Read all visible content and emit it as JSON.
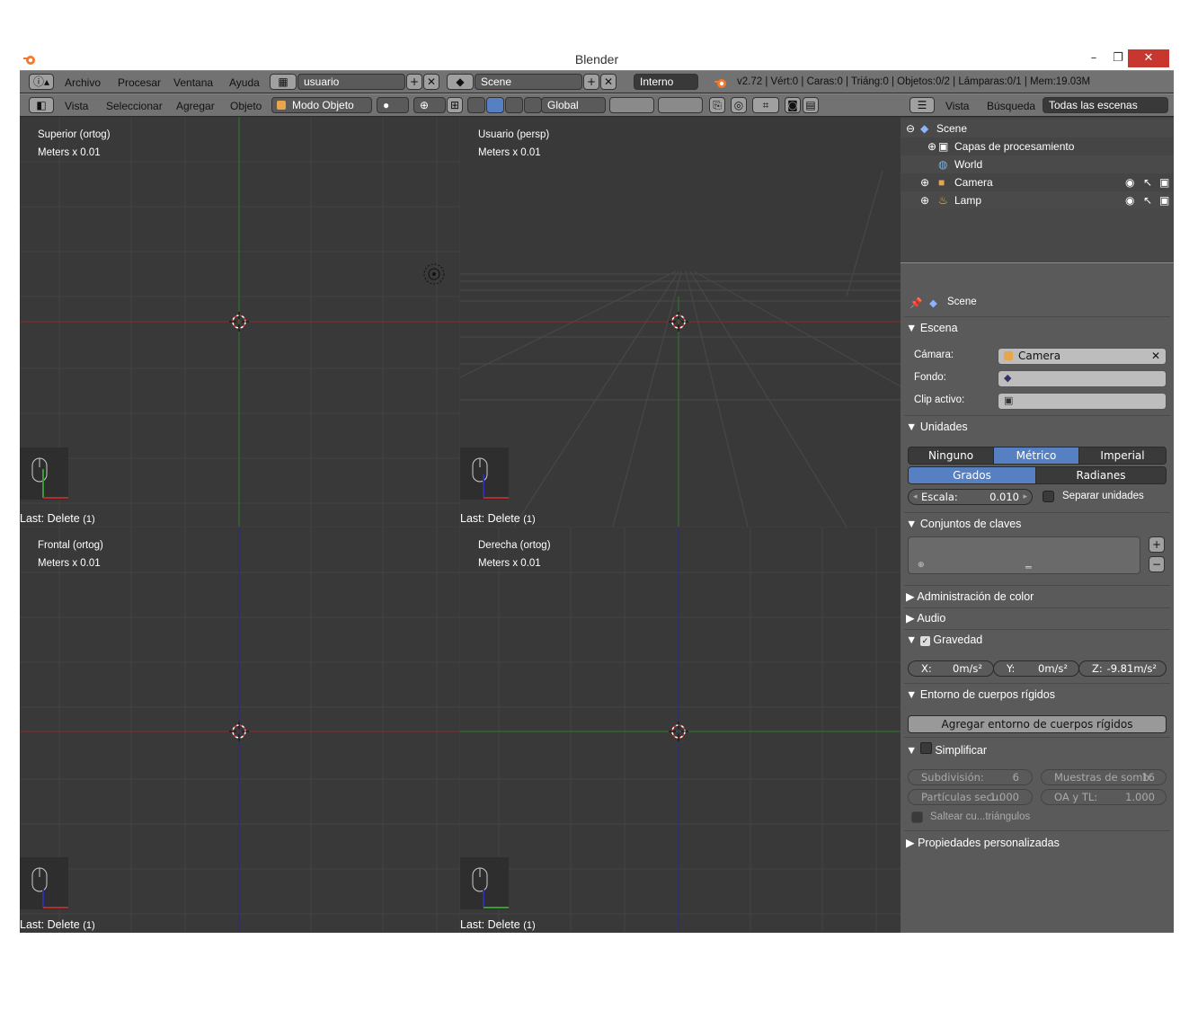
{
  "window": {
    "title": "Blender",
    "minimize": "–",
    "restore": "❐",
    "close": "✕"
  },
  "info_header": {
    "menus": [
      "Archivo",
      "Procesar",
      "Ventana",
      "Ayuda"
    ],
    "screen": "usuario",
    "scene": "Scene",
    "engine": "Interno",
    "stats": "v2.72 | Vért:0 | Caras:0 | Triáng:0 | Objetos:0/2 | Lámparas:0/1 | Mem:19.03M"
  },
  "view3d_header": {
    "menus": [
      "Vista",
      "Seleccionar",
      "Agregar",
      "Objeto"
    ],
    "mode": "Modo Objeto",
    "orientation": "Global"
  },
  "viewports": [
    {
      "title": "Superior (ortog)",
      "units": "Meters x 0.01",
      "last": "Last: Delete",
      "count": "(1)"
    },
    {
      "title": "Usuario (persp)",
      "units": "Meters x 0.01",
      "last": "Last: Delete",
      "count": "(1)"
    },
    {
      "title": "Frontal (ortog)",
      "units": "Meters x 0.01",
      "last": "Last: Delete",
      "count": "(1)"
    },
    {
      "title": "Derecha (ortog)",
      "units": "Meters x 0.01",
      "last": "Last: Delete",
      "count": "(1)"
    }
  ],
  "outliner": {
    "menus": [
      "Vista",
      "Búsqueda"
    ],
    "filter": "Todas las escenas",
    "items": [
      "Scene",
      "Capas de procesamiento",
      "World",
      "Camera",
      "Lamp"
    ]
  },
  "properties": {
    "context": "Scene",
    "escena": {
      "header": "Escena",
      "camera_label": "Cámara:",
      "camera_value": "Camera",
      "fondo_label": "Fondo:",
      "clip_label": "Clip activo:"
    },
    "unidades": {
      "header": "Unidades",
      "systems": [
        "Ninguno",
        "Métrico",
        "Imperial"
      ],
      "rotation": [
        "Grados",
        "Radianes"
      ],
      "scale_label": "Escala:",
      "scale_value": "0.010",
      "separate": "Separar unidades"
    },
    "keying": {
      "header": "Conjuntos de claves"
    },
    "color_mgmt": {
      "header": "Administración de color"
    },
    "audio": {
      "header": "Audio"
    },
    "gravity": {
      "header": "Gravedad",
      "x_label": "X:",
      "x": "0m/s²",
      "y_label": "Y:",
      "y": "0m/s²",
      "z_label": "Z:",
      "z": "-9.81m/s²"
    },
    "rigid": {
      "header": "Entorno de cuerpos rígidos",
      "button": "Agregar entorno de cuerpos rígidos"
    },
    "simplify": {
      "header": "Simplificar",
      "subdiv_label": "Subdivisión:",
      "subdiv": "6",
      "shadow_label": "Muestras de somb:",
      "shadow": "16",
      "particles_label": "Partículas secu:",
      "particles": "1.000",
      "ao_label": "OA y TL:",
      "ao": "1.000",
      "skip": "Saltear cu...triángulos"
    },
    "custom": {
      "header": "Propiedades personalizadas"
    }
  },
  "colors": {
    "x_axis": "#b03030",
    "y_axis": "#3a9a3a",
    "z_axis": "#3030a8",
    "accent": "#5680c2",
    "close": "#c7372f"
  }
}
